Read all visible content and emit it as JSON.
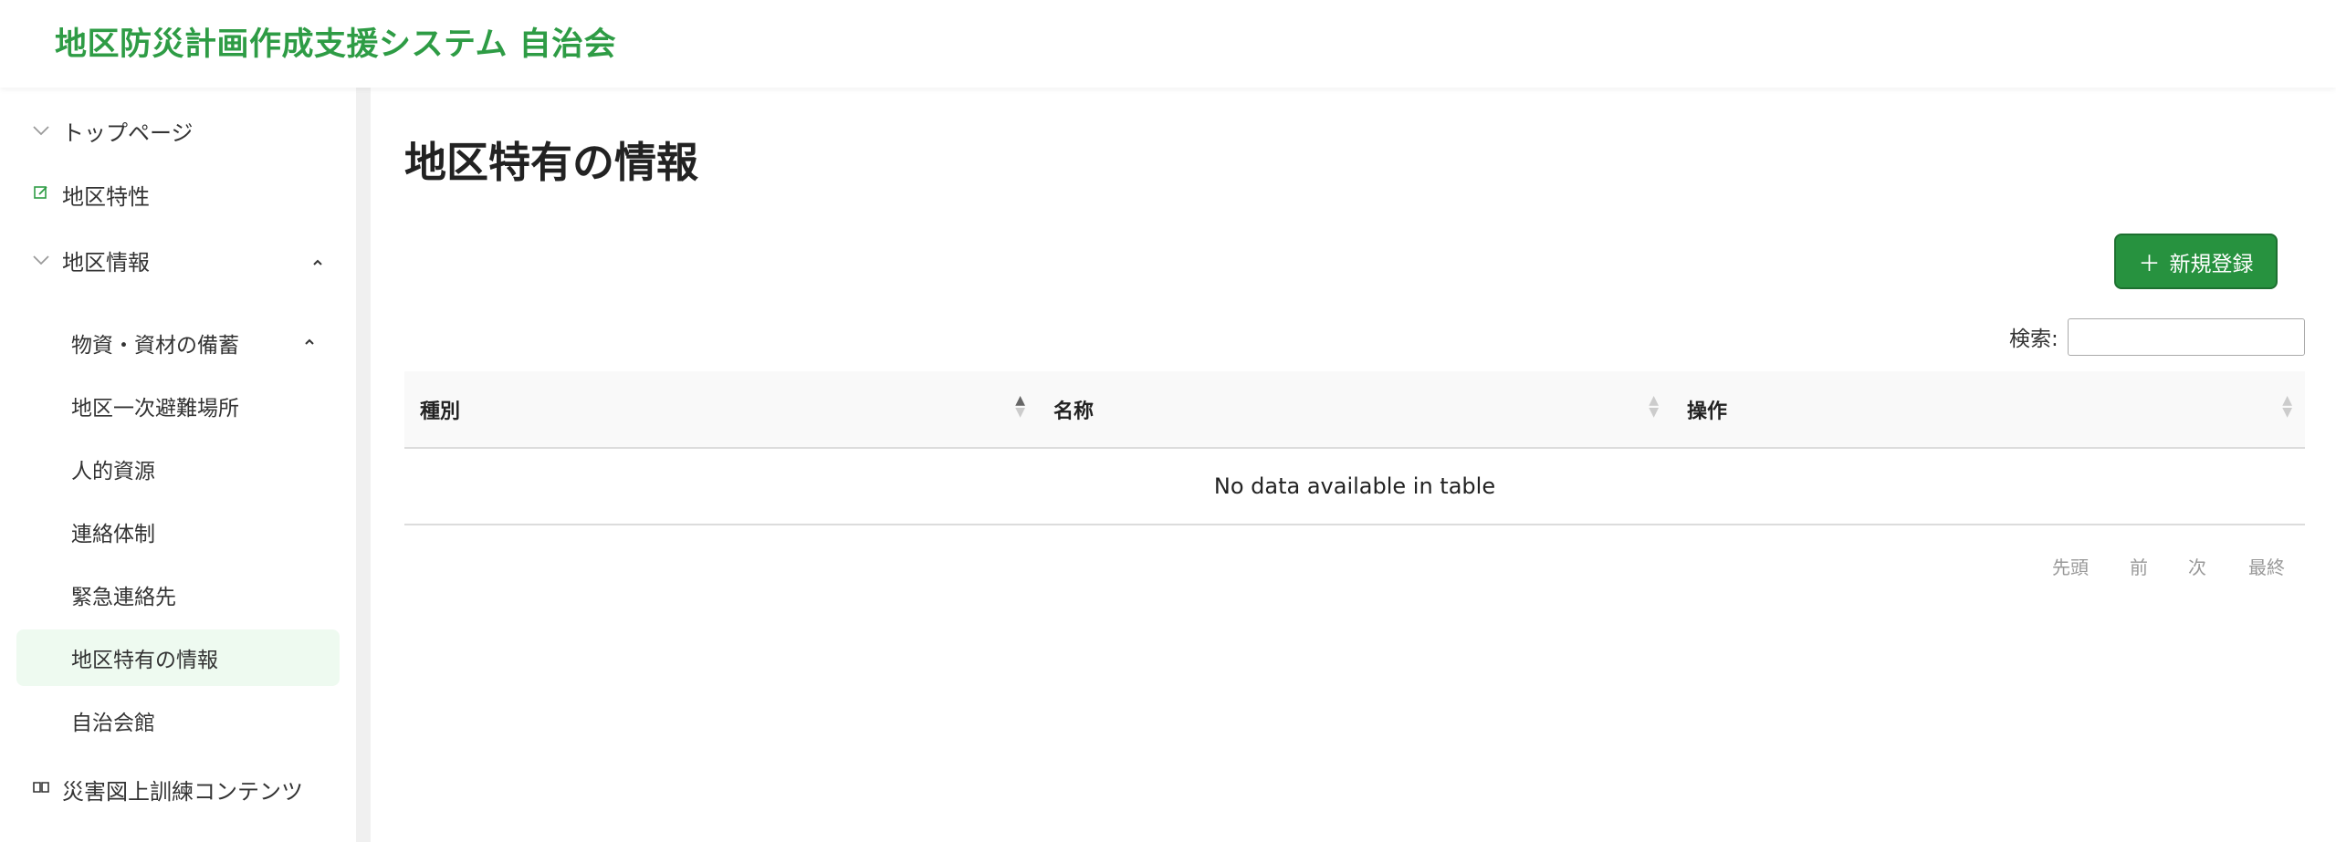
{
  "header": {
    "app_title": "地区防災計画作成支援システム 自治会"
  },
  "sidebar": {
    "top_page": "トップページ",
    "district_characteristics": "地区特性",
    "district_info": "地区情報",
    "supplies": "物資・資材の備蓄",
    "sub_items": [
      "地区一次避難場所",
      "人的資源",
      "連絡体制",
      "緊急連絡先",
      "地区特有の情報",
      "自治会館"
    ],
    "training": "災害図上訓練コンテンツ"
  },
  "main": {
    "page_title": "地区特有の情報",
    "new_button_label": "新規登録",
    "search_label": "検索:",
    "search_value": "",
    "columns": [
      "種別",
      "名称",
      "操作"
    ],
    "empty_message": "No data available in table",
    "pager": [
      "先頭",
      "前",
      "次",
      "最終"
    ]
  },
  "colors": {
    "accent": "#2e9c45",
    "button": "#27923f",
    "active_bg": "#eefaf0"
  },
  "icons": {
    "top_page": "chevron-down-icon",
    "district_characteristics": "edit-icon",
    "district_info": "chevron-down-icon",
    "training": "book-icon",
    "expand": "chevron-up-icon",
    "new_button": "plus-icon"
  }
}
